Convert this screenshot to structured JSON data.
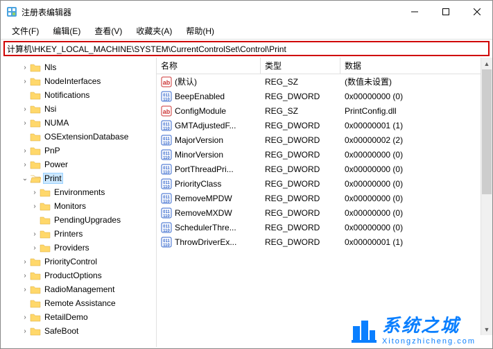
{
  "window": {
    "title": "注册表编辑器"
  },
  "menu": {
    "file": "文件(F)",
    "edit": "编辑(E)",
    "view": "查看(V)",
    "favorites": "收藏夹(A)",
    "help": "帮助(H)"
  },
  "address": "计算机\\HKEY_LOCAL_MACHINE\\SYSTEM\\CurrentControlSet\\Control\\Print",
  "tree": [
    {
      "depth": 2,
      "expand": ">",
      "label": "Nls"
    },
    {
      "depth": 2,
      "expand": ">",
      "label": "NodeInterfaces"
    },
    {
      "depth": 2,
      "expand": "",
      "label": "Notifications"
    },
    {
      "depth": 2,
      "expand": ">",
      "label": "Nsi"
    },
    {
      "depth": 2,
      "expand": ">",
      "label": "NUMA"
    },
    {
      "depth": 2,
      "expand": "",
      "label": "OSExtensionDatabase"
    },
    {
      "depth": 2,
      "expand": ">",
      "label": "PnP"
    },
    {
      "depth": 2,
      "expand": ">",
      "label": "Power"
    },
    {
      "depth": 2,
      "expand": "v",
      "label": "Print",
      "sel": true
    },
    {
      "depth": 3,
      "expand": ">",
      "label": "Environments"
    },
    {
      "depth": 3,
      "expand": ">",
      "label": "Monitors"
    },
    {
      "depth": 3,
      "expand": "",
      "label": "PendingUpgrades"
    },
    {
      "depth": 3,
      "expand": ">",
      "label": "Printers"
    },
    {
      "depth": 3,
      "expand": ">",
      "label": "Providers"
    },
    {
      "depth": 2,
      "expand": ">",
      "label": "PriorityControl"
    },
    {
      "depth": 2,
      "expand": ">",
      "label": "ProductOptions"
    },
    {
      "depth": 2,
      "expand": ">",
      "label": "RadioManagement"
    },
    {
      "depth": 2,
      "expand": "",
      "label": "Remote Assistance"
    },
    {
      "depth": 2,
      "expand": ">",
      "label": "RetailDemo"
    },
    {
      "depth": 2,
      "expand": ">",
      "label": "SafeBoot"
    }
  ],
  "list": {
    "headers": {
      "name": "名称",
      "type": "类型",
      "data": "数据"
    },
    "rows": [
      {
        "i": "sz",
        "name": "(默认)",
        "type": "REG_SZ",
        "data": "(数值未设置)"
      },
      {
        "i": "dw",
        "name": "BeepEnabled",
        "type": "REG_DWORD",
        "data": "0x00000000 (0)"
      },
      {
        "i": "sz",
        "name": "ConfigModule",
        "type": "REG_SZ",
        "data": "PrintConfig.dll"
      },
      {
        "i": "dw",
        "name": "GMTAdjustedF...",
        "type": "REG_DWORD",
        "data": "0x00000001 (1)"
      },
      {
        "i": "dw",
        "name": "MajorVersion",
        "type": "REG_DWORD",
        "data": "0x00000002 (2)"
      },
      {
        "i": "dw",
        "name": "MinorVersion",
        "type": "REG_DWORD",
        "data": "0x00000000 (0)"
      },
      {
        "i": "dw",
        "name": "PortThreadPri...",
        "type": "REG_DWORD",
        "data": "0x00000000 (0)"
      },
      {
        "i": "dw",
        "name": "PriorityClass",
        "type": "REG_DWORD",
        "data": "0x00000000 (0)"
      },
      {
        "i": "dw",
        "name": "RemoveMPDW",
        "type": "REG_DWORD",
        "data": "0x00000000 (0)"
      },
      {
        "i": "dw",
        "name": "RemoveMXDW",
        "type": "REG_DWORD",
        "data": "0x00000000 (0)"
      },
      {
        "i": "dw",
        "name": "SchedulerThre...",
        "type": "REG_DWORD",
        "data": "0x00000000 (0)"
      },
      {
        "i": "dw",
        "name": "ThrowDriverEx...",
        "type": "REG_DWORD",
        "data": "0x00000001 (1)"
      }
    ]
  },
  "watermark": {
    "main": "系统之城",
    "sub": "Xitongzhicheng.com"
  }
}
